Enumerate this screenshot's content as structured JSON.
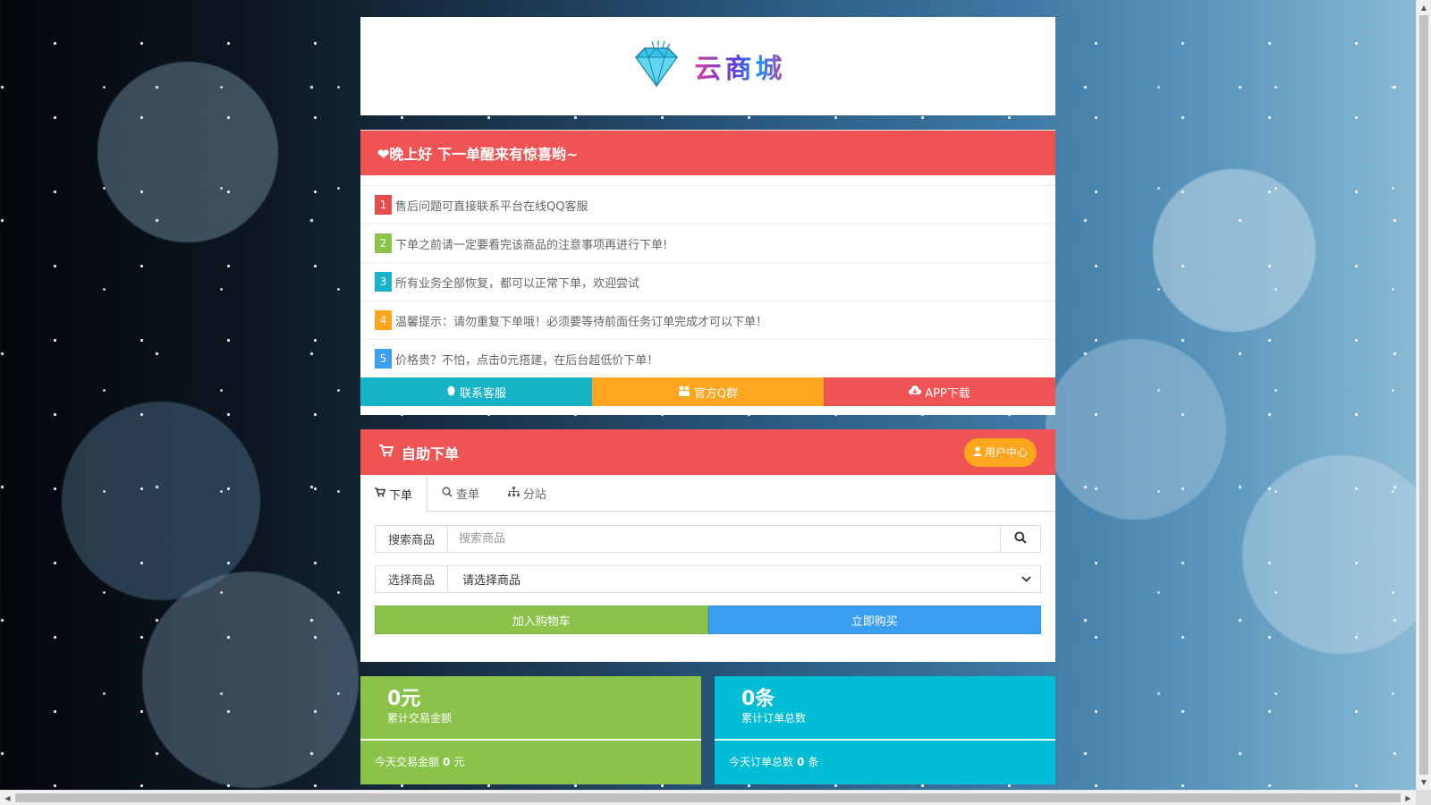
{
  "site": {
    "logo_text": "云商城"
  },
  "notice": {
    "title": "❤晚上好 下一单醒来有惊喜哟~",
    "items": [
      {
        "num": "1",
        "text": "售后问题可直接联系平台在线QQ客服",
        "color": "#e64c4c"
      },
      {
        "num": "2",
        "text": "下单之前请一定要看完该商品的注意事项再进行下单!",
        "color": "#8bc34a"
      },
      {
        "num": "3",
        "text": "所有业务全部恢复，都可以正常下单，欢迎尝试",
        "color": "#17b4c8"
      },
      {
        "num": "4",
        "text": "温馨提示：请勿重复下单哦！必须要等待前面任务订单完成才可以下单！",
        "color": "#ffa51e"
      },
      {
        "num": "5",
        "text": "价格贵？不怕，点击0元搭建，在后台超低价下单！",
        "color": "#3a9ff0"
      }
    ],
    "buttons": [
      {
        "label": "联系客服",
        "icon": "qq-penguin-icon",
        "color": "#17b4c8"
      },
      {
        "label": "官方Q群",
        "icon": "group-icon",
        "color": "#ffa51e"
      },
      {
        "label": "APP下载",
        "icon": "cloud-download-icon",
        "color": "#f05353"
      }
    ]
  },
  "order": {
    "title": "自助下单",
    "user_center": "用户中心",
    "tabs": [
      {
        "label": "下单",
        "icon": "cart-icon",
        "active": true
      },
      {
        "label": "查单",
        "icon": "search-icon",
        "active": false
      },
      {
        "label": "分站",
        "icon": "sitemap-icon",
        "active": false
      }
    ],
    "search": {
      "label": "搜索商品",
      "placeholder": "搜索商品"
    },
    "select": {
      "label": "选择商品",
      "value": "请选择商品"
    },
    "add_cart": "加入购物车",
    "buy_now": "立即购买"
  },
  "stats": [
    {
      "value": "0元",
      "label": "累计交易金额",
      "today_prefix": "今天交易金额",
      "today_value": "0",
      "today_unit": "元",
      "color": "#8bc34a"
    },
    {
      "value": "0条",
      "label": "累计订单总数",
      "today_prefix": "今天订单总数",
      "today_value": "0",
      "today_unit": "条",
      "color": "#00bcd4"
    }
  ],
  "colors": {
    "header_red": "#f05353",
    "green": "#8bc34a",
    "blue": "#3a9ff0",
    "cyan": "#17b4c8",
    "orange": "#ffa51e"
  }
}
